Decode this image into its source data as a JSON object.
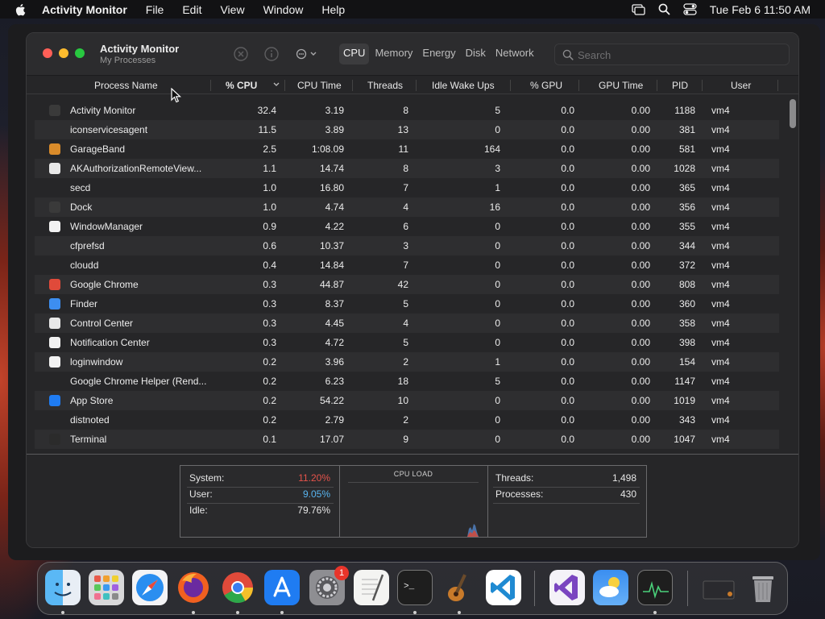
{
  "menubar": {
    "app_name": "Activity Monitor",
    "items": [
      "File",
      "Edit",
      "View",
      "Window",
      "Help"
    ],
    "clock": "Tue Feb 6  11:50 AM"
  },
  "window": {
    "title": "Activity Monitor",
    "subtitle": "My Processes",
    "tabs": [
      "CPU",
      "Memory",
      "Energy",
      "Disk",
      "Network"
    ],
    "active_tab": "CPU",
    "search_placeholder": "Search"
  },
  "columns": [
    "Process Name",
    "% CPU",
    "CPU Time",
    "Threads",
    "Idle Wake Ups",
    "% GPU",
    "GPU Time",
    "PID",
    "User"
  ],
  "processes": [
    {
      "icon": "activity-monitor-icon",
      "color": "#3a3a3a",
      "name": "Activity Monitor",
      "cpu": "32.4",
      "cpu_time": "3.19",
      "threads": "8",
      "idle": "5",
      "gpu": "0.0",
      "gpu_time": "0.00",
      "pid": "1188",
      "user": "vm4"
    },
    {
      "icon": "",
      "color": "",
      "name": "iconservicesagent",
      "cpu": "11.5",
      "cpu_time": "3.89",
      "threads": "13",
      "idle": "0",
      "gpu": "0.0",
      "gpu_time": "0.00",
      "pid": "381",
      "user": "vm4"
    },
    {
      "icon": "garageband-icon",
      "color": "#d98b2a",
      "name": "GarageBand",
      "cpu": "2.5",
      "cpu_time": "1:08.09",
      "threads": "11",
      "idle": "164",
      "gpu": "0.0",
      "gpu_time": "0.00",
      "pid": "581",
      "user": "vm4"
    },
    {
      "icon": "shield-icon",
      "color": "#e8e8e8",
      "name": "AKAuthorizationRemoteView...",
      "cpu": "1.1",
      "cpu_time": "14.74",
      "threads": "8",
      "idle": "3",
      "gpu": "0.0",
      "gpu_time": "0.00",
      "pid": "1028",
      "user": "vm4"
    },
    {
      "icon": "",
      "color": "",
      "name": "secd",
      "cpu": "1.0",
      "cpu_time": "16.80",
      "threads": "7",
      "idle": "1",
      "gpu": "0.0",
      "gpu_time": "0.00",
      "pid": "365",
      "user": "vm4"
    },
    {
      "icon": "dock-icon",
      "color": "#3a3a3a",
      "name": "Dock",
      "cpu": "1.0",
      "cpu_time": "4.74",
      "threads": "4",
      "idle": "16",
      "gpu": "0.0",
      "gpu_time": "0.00",
      "pid": "356",
      "user": "vm4"
    },
    {
      "icon": "window-manager-icon",
      "color": "#f2f2f2",
      "name": "WindowManager",
      "cpu": "0.9",
      "cpu_time": "4.22",
      "threads": "6",
      "idle": "0",
      "gpu": "0.0",
      "gpu_time": "0.00",
      "pid": "355",
      "user": "vm4"
    },
    {
      "icon": "",
      "color": "",
      "name": "cfprefsd",
      "cpu": "0.6",
      "cpu_time": "10.37",
      "threads": "3",
      "idle": "0",
      "gpu": "0.0",
      "gpu_time": "0.00",
      "pid": "344",
      "user": "vm4"
    },
    {
      "icon": "",
      "color": "",
      "name": "cloudd",
      "cpu": "0.4",
      "cpu_time": "14.84",
      "threads": "7",
      "idle": "0",
      "gpu": "0.0",
      "gpu_time": "0.00",
      "pid": "372",
      "user": "vm4"
    },
    {
      "icon": "chrome-icon",
      "color": "#e04a3a",
      "name": "Google Chrome",
      "cpu": "0.3",
      "cpu_time": "44.87",
      "threads": "42",
      "idle": "0",
      "gpu": "0.0",
      "gpu_time": "0.00",
      "pid": "808",
      "user": "vm4"
    },
    {
      "icon": "finder-icon",
      "color": "#3d8ef0",
      "name": "Finder",
      "cpu": "0.3",
      "cpu_time": "8.37",
      "threads": "5",
      "idle": "0",
      "gpu": "0.0",
      "gpu_time": "0.00",
      "pid": "360",
      "user": "vm4"
    },
    {
      "icon": "control-center-icon",
      "color": "#e8e8e8",
      "name": "Control Center",
      "cpu": "0.3",
      "cpu_time": "4.45",
      "threads": "4",
      "idle": "0",
      "gpu": "0.0",
      "gpu_time": "0.00",
      "pid": "358",
      "user": "vm4"
    },
    {
      "icon": "notification-center-icon",
      "color": "#f2f2f2",
      "name": "Notification Center",
      "cpu": "0.3",
      "cpu_time": "4.72",
      "threads": "5",
      "idle": "0",
      "gpu": "0.0",
      "gpu_time": "0.00",
      "pid": "398",
      "user": "vm4"
    },
    {
      "icon": "loginwindow-icon",
      "color": "#f2f2f2",
      "name": "loginwindow",
      "cpu": "0.2",
      "cpu_time": "3.96",
      "threads": "2",
      "idle": "1",
      "gpu": "0.0",
      "gpu_time": "0.00",
      "pid": "154",
      "user": "vm4"
    },
    {
      "icon": "",
      "color": "",
      "name": "Google Chrome Helper (Rend...",
      "cpu": "0.2",
      "cpu_time": "6.23",
      "threads": "18",
      "idle": "5",
      "gpu": "0.0",
      "gpu_time": "0.00",
      "pid": "1147",
      "user": "vm4"
    },
    {
      "icon": "app-store-icon",
      "color": "#1f7cf2",
      "name": "App Store",
      "cpu": "0.2",
      "cpu_time": "54.22",
      "threads": "10",
      "idle": "0",
      "gpu": "0.0",
      "gpu_time": "0.00",
      "pid": "1019",
      "user": "vm4"
    },
    {
      "icon": "",
      "color": "",
      "name": "distnoted",
      "cpu": "0.2",
      "cpu_time": "2.79",
      "threads": "2",
      "idle": "0",
      "gpu": "0.0",
      "gpu_time": "0.00",
      "pid": "343",
      "user": "vm4"
    },
    {
      "icon": "terminal-icon",
      "color": "#2b2b2b",
      "name": "Terminal",
      "cpu": "0.1",
      "cpu_time": "17.07",
      "threads": "9",
      "idle": "0",
      "gpu": "0.0",
      "gpu_time": "0.00",
      "pid": "1047",
      "user": "vm4"
    }
  ],
  "summary": {
    "system_label": "System:",
    "system_value": "11.20%",
    "user_label": "User:",
    "user_value": "9.05%",
    "idle_label": "Idle:",
    "idle_value": "79.76%",
    "cpu_load_label": "CPU LOAD",
    "threads_label": "Threads:",
    "threads_value": "1,498",
    "processes_label": "Processes:",
    "processes_value": "430",
    "system_color": "#e5534b",
    "user_color": "#58b4f0"
  },
  "dock": {
    "badge": "1",
    "apps": [
      "finder-icon",
      "launchpad-icon",
      "safari-icon",
      "firefox-icon",
      "chrome-icon",
      "app-store-icon",
      "system-settings-icon",
      "textedit-icon",
      "terminal-icon",
      "garageband-icon",
      "vscode-icon",
      "visual-studio-icon",
      "weather-icon",
      "activity-monitor-icon",
      "downloads-icon",
      "trash-icon"
    ]
  }
}
